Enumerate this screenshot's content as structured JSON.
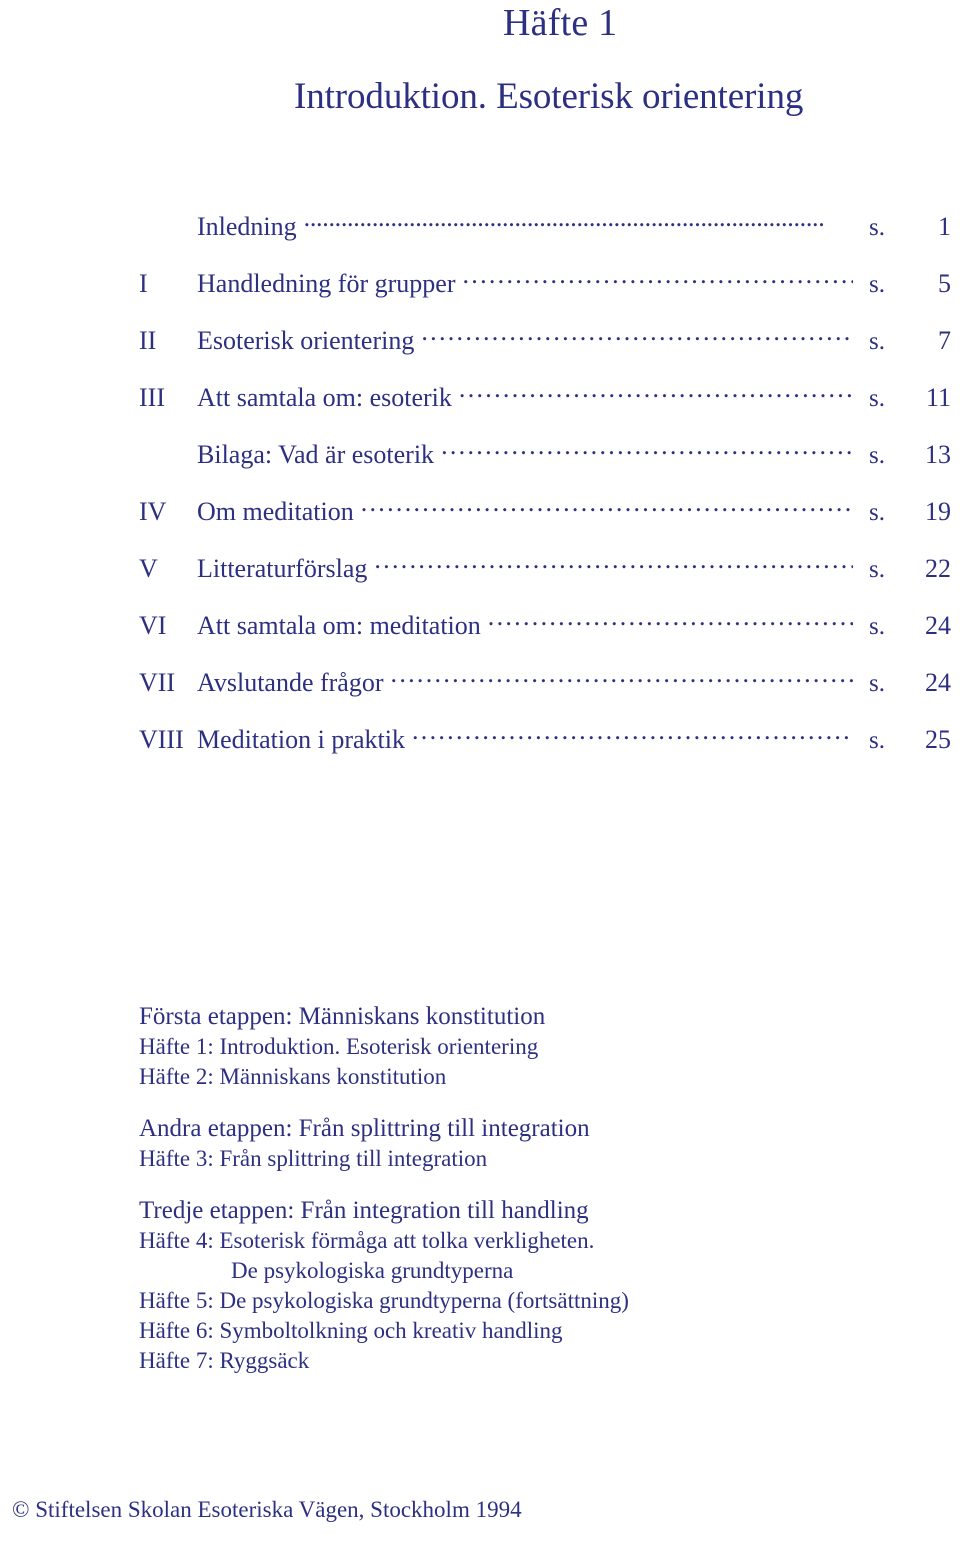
{
  "colors": {
    "text": "#2d3080",
    "page_background": "#ffffff"
  },
  "header": {
    "booklet_number": "Häfte 1",
    "title": "Introduktion. Esoterisk orientering"
  },
  "toc": {
    "page_prefix": "s.",
    "entries": [
      {
        "numeral": "",
        "title": "Inledning",
        "prefix": "s.",
        "page": "1",
        "leader": "tight"
      },
      {
        "numeral": "I",
        "title": "Handledning för grupper",
        "prefix": "s.",
        "page": "5",
        "leader": "normal"
      },
      {
        "numeral": "II",
        "title": "Esoterisk orientering",
        "prefix": "s.",
        "page": "7",
        "leader": "normal"
      },
      {
        "numeral": "III",
        "title": "Att samtala om: esoterik",
        "prefix": "s.",
        "page": "11",
        "leader": "normal"
      },
      {
        "numeral": "",
        "title": "Bilaga: Vad är esoterik",
        "prefix": "s.",
        "page": "13",
        "leader": "normal"
      },
      {
        "numeral": "IV",
        "title": "Om meditation",
        "prefix": "s.",
        "page": "19",
        "leader": "normal"
      },
      {
        "numeral": "V",
        "title": "Litteraturförslag",
        "prefix": "s.",
        "page": "22",
        "leader": "normal"
      },
      {
        "numeral": "VI",
        "title": "Att samtala om: meditation",
        "prefix": "s.",
        "page": "24",
        "leader": "normal"
      },
      {
        "numeral": "VII",
        "title": "Avslutande frågor",
        "prefix": "s.",
        "page": "24",
        "leader": "normal"
      },
      {
        "numeral": "VIII",
        "title": "Meditation i praktik",
        "prefix": "s.",
        "page": "25",
        "leader": "normal"
      }
    ]
  },
  "stages": [
    {
      "heading": "Första etappen: Människans konstitution",
      "items": [
        {
          "text": "Häfte 1: Introduktion. Esoterisk orientering",
          "indented": false
        },
        {
          "text": "Häfte 2: Människans konstitution",
          "indented": false
        }
      ]
    },
    {
      "heading": "Andra etappen: Från splittring till integration",
      "items": [
        {
          "text": "Häfte 3: Från splittring till integration",
          "indented": false
        }
      ]
    },
    {
      "heading": "Tredje etappen: Från integration till handling",
      "items": [
        {
          "text": "Häfte 4: Esoterisk förmåga att tolka verkligheten.",
          "indented": false
        },
        {
          "text": "De psykologiska  grundtyperna",
          "indented": true
        },
        {
          "text": "Häfte 5: De psykologiska grundtyperna (fortsättning)",
          "indented": false
        },
        {
          "text": "Häfte 6: Symboltolkning och kreativ handling",
          "indented": false
        },
        {
          "text": "Häfte 7: Ryggsäck",
          "indented": false
        }
      ]
    }
  ],
  "footer": {
    "copyright": "© Stiftelsen Skolan Esoteriska Vägen, Stockholm 1994"
  }
}
